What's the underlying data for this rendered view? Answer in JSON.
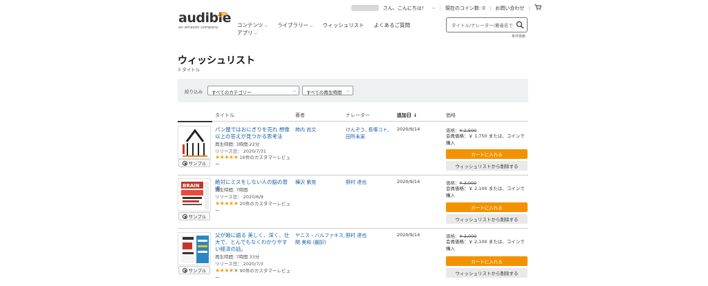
{
  "header": {
    "greeting": "さん、こんにちは！",
    "coin_balance": "現在のコイン数: 0",
    "contact": "お問い合わせ",
    "logo_text": "audible",
    "logo_sub": "an amazon company",
    "nav": [
      "コンテンツ",
      "ライブラリー",
      "ウィッシュリスト",
      "よくあるご質問"
    ],
    "nav_apps": "アプリ",
    "search_placeholder": "タイトル/ナレーター/著者名で",
    "advanced_search": "条件検索"
  },
  "page": {
    "title": "ウィッシュリスト",
    "count": "3 タイトル"
  },
  "filter": {
    "label": "絞り込み",
    "category": "すべてのカテゴリー",
    "duration": "すべての再生時間"
  },
  "columns": {
    "title": "タイトル",
    "author": "著者",
    "narrator": "ナレーター",
    "added": "追加日",
    "price": "価格"
  },
  "items": [
    {
      "title": "パン屋ではおにぎりを売れ 想像以上の答えが見つかる思考法",
      "duration": "再生時間: 3時間 22分",
      "release": "リリース日： 2020/7/31",
      "rating": 4.5,
      "reviews": "16件のカスタマーレビュー",
      "author": "柿内 尚文",
      "narrator": "けんぞう, 長塚コト, 田所未寅",
      "added": "2020/9/14",
      "price_label": "価格：",
      "list_price": "¥ 2,500",
      "member_price": "会員価格：￥ 1,750 または、コインで購入",
      "cart": "カートに入れる",
      "remove": "ウィッシュリストから削除する",
      "sample": "サンプル"
    },
    {
      "title": "絶対にミスをしない人の脳の習慣",
      "duration": "再生時間: 7時間",
      "release": "リリース日： 2020/6/9",
      "rating": 4.5,
      "reviews": "20件のカスタマーレビュー",
      "author": "樺沢 紫苑",
      "narrator": "野村 達也",
      "added": "2020/9/14",
      "price_label": "価格：",
      "list_price": "¥ 3,000",
      "member_price": "会員価格：￥ 2,100 または、コインで購入",
      "cart": "カートに入れる",
      "remove": "ウィッシュリストから削除する",
      "sample": "サンプル"
    },
    {
      "title": "父が娘に語る 美しく、深く、壮大で、とんでもなくわかりやすい経済の話。",
      "duration": "再生時間: 7時間 33分",
      "release": "リリース日： 2020/7/3",
      "rating": 4,
      "reviews": "90件のカスタマーレビュー",
      "author": "ヤニス・バルファキス, 関 美和 (翻訳)",
      "narrator": "野村 達也",
      "added": "2020/9/14",
      "price_label": "価格：",
      "list_price": "¥ 3,000",
      "member_price": "会員価格：￥ 2,100 または、コインで購入",
      "cart": "カートに入れる",
      "remove": "ウィッシュリストから削除する",
      "sample": "サンプル"
    }
  ],
  "colors": {
    "accent": "#f39200",
    "link": "#1a5fa8",
    "filter_bg": "#eef1f2"
  }
}
